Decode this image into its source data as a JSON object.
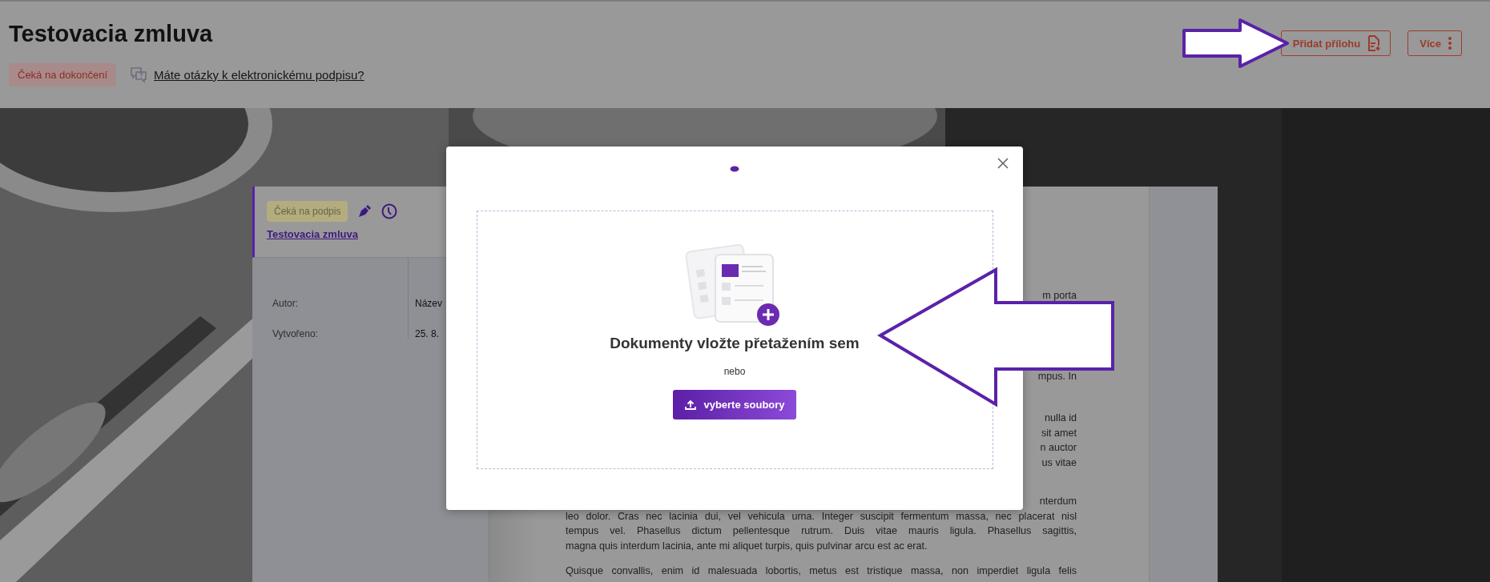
{
  "header": {
    "title": "Testovacia zmluva",
    "status_badge": "Čeká na dokončení",
    "help_link": "Máte otázky k elektronickému podpisu?"
  },
  "actions": [
    {
      "kind": "attach",
      "label": "Přidat přílohu"
    },
    {
      "kind": "more",
      "label": "Více"
    }
  ],
  "document": {
    "status_badge": "Čeká na podpis",
    "title_link": "Testovacia zmluva",
    "details": [
      {
        "label": "Autor:",
        "value": "Název"
      },
      {
        "label": "Vytvořeno:",
        "value": "25. 8."
      }
    ],
    "paragraphs": [
      {
        "lines": [
          {
            "kind": "cut",
            "text": "m porta"
          }
        ]
      },
      {
        "lines": [
          {
            "kind": "cut",
            "text": "mpus. In"
          }
        ]
      },
      {
        "lines": [
          {
            "kind": "cut",
            "text": "nulla id"
          },
          {
            "kind": "cut",
            "text": "sit amet"
          },
          {
            "kind": "cut",
            "text": "n auctor"
          },
          {
            "kind": "cut",
            "text": "us vitae"
          }
        ]
      },
      {
        "lines": [
          {
            "kind": "cut",
            "text": "nterdum"
          },
          {
            "kind": "full",
            "text": "leo dolor. Cras nec lacinia dui, vel vehicula urna. Integer suscipit fermentum massa, nec placerat nisl"
          },
          {
            "kind": "full",
            "text": "tempus vel. Phasellus dictum pellentesque rutrum. Duis vitae mauris ligula. Phasellus sagittis,"
          },
          {
            "kind": "end",
            "text": "magna quis interdum lacinia, ante mi aliquet turpis, quis pulvinar arcu est ac erat."
          }
        ]
      },
      {
        "lines": [
          {
            "kind": "full",
            "text": "Quisque convallis, enim id malesuada lobortis, metus est tristique massa, non imperdiet ligula felis"
          }
        ]
      }
    ]
  },
  "upload_dialog": {
    "heading": "Dokumenty vložte přetažením sem",
    "separator": "nebo",
    "button": "vyberte soubory"
  }
}
